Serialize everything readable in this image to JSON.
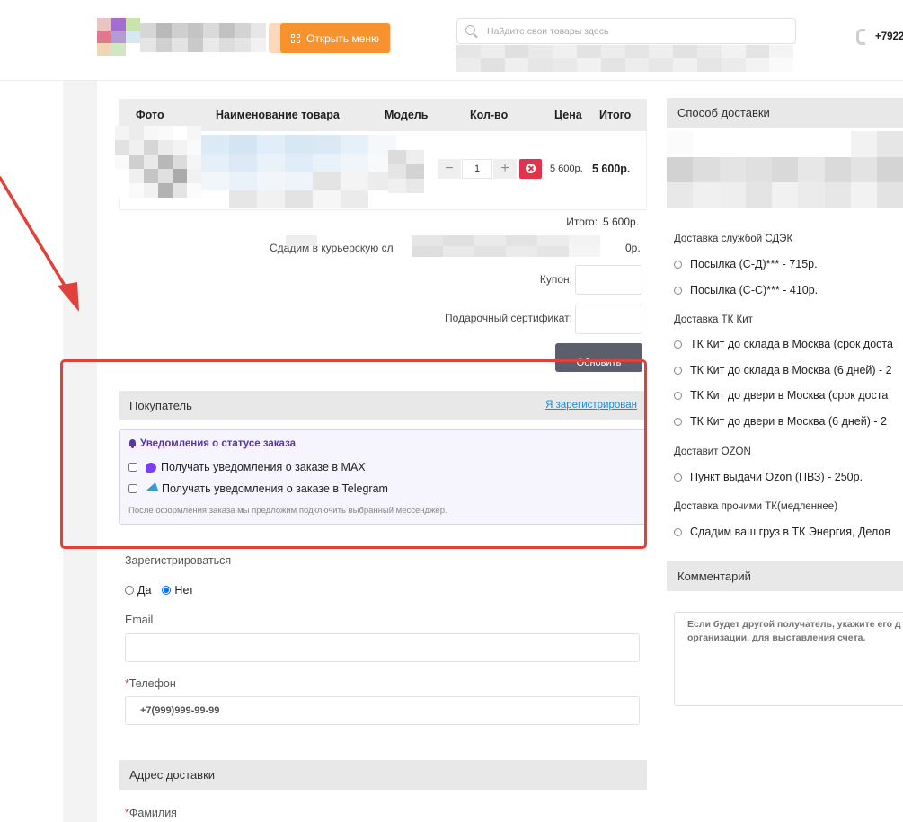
{
  "header": {
    "menu_button_label": "Открыть меню",
    "search_placeholder": "Найдите свои товары здесь",
    "phone": "+7922"
  },
  "cart": {
    "columns": [
      "Фото",
      "Наименование товара",
      "Модель",
      "Кол-во",
      "Цена",
      "Итого"
    ],
    "row": {
      "quantity": "1",
      "price": "5 600р.",
      "total": "5 600р."
    },
    "summary_total_label": "Итого:",
    "summary_total_value": "5 600р.",
    "courier_label_partial": "Сдадим в курьерскую сл",
    "courier_value": "0р.",
    "coupon_label": "Купон:",
    "gift_label": "Подарочный сертификат:",
    "update_button_label": "Обновить"
  },
  "buyer": {
    "section_title": "Покупатель",
    "registered_link": "Я зарегистрирован",
    "notifications_title": "Уведомления о статусе заказа",
    "option_max": "Получать уведомления о заказе в MAX",
    "option_telegram": "Получать уведомления о заказе в Telegram",
    "note": "После оформления заказа мы предложим подключить выбранный мессенджер.",
    "register_label": "Зарегистрироваться",
    "register_yes": "Да",
    "register_no": "Нет",
    "register_selected": "Нет",
    "email_label": "Email",
    "email_value": "",
    "phone_label": "Телефон",
    "phone_value": "+7(999)999-99-99"
  },
  "address": {
    "section_title": "Адрес доставки",
    "lastname_label": "Фамилия"
  },
  "shipping": {
    "section_title": "Способ доставки",
    "groups": [
      {
        "label": "Доставка службой СДЭК",
        "options": [
          "Посылка (С-Д)*** - 715р.",
          "Посылка (С-С)*** - 410р."
        ]
      },
      {
        "label": "Доставка ТК Кит",
        "options": [
          "ТК Кит до склада в Москва (срок доста",
          "ТК Кит до склада в Москва (6 дней) - 2",
          "ТК Кит до двери в Москва (срок доста",
          "ТК Кит до двери в Москва (6 дней) - 2"
        ]
      },
      {
        "label": "Доставит OZON",
        "options": [
          "Пункт выдачи Ozon (ПВЗ) - 250р."
        ]
      },
      {
        "label": "Доставка прочими ТК(медленнее)",
        "options": [
          "Сдадим ваш груз в ТК Энергия, Делов"
        ]
      }
    ]
  },
  "comment": {
    "section_title": "Комментарий",
    "placeholder": "Если будет другой получатель, укажите его д организации, для выставления счета."
  },
  "colors": {
    "accent_orange": "#f7932f",
    "annotation_red": "#e2403a",
    "link_blue": "#1a8cd8",
    "notify_purple": "#5b35a8",
    "remove_red": "#e0334c"
  }
}
